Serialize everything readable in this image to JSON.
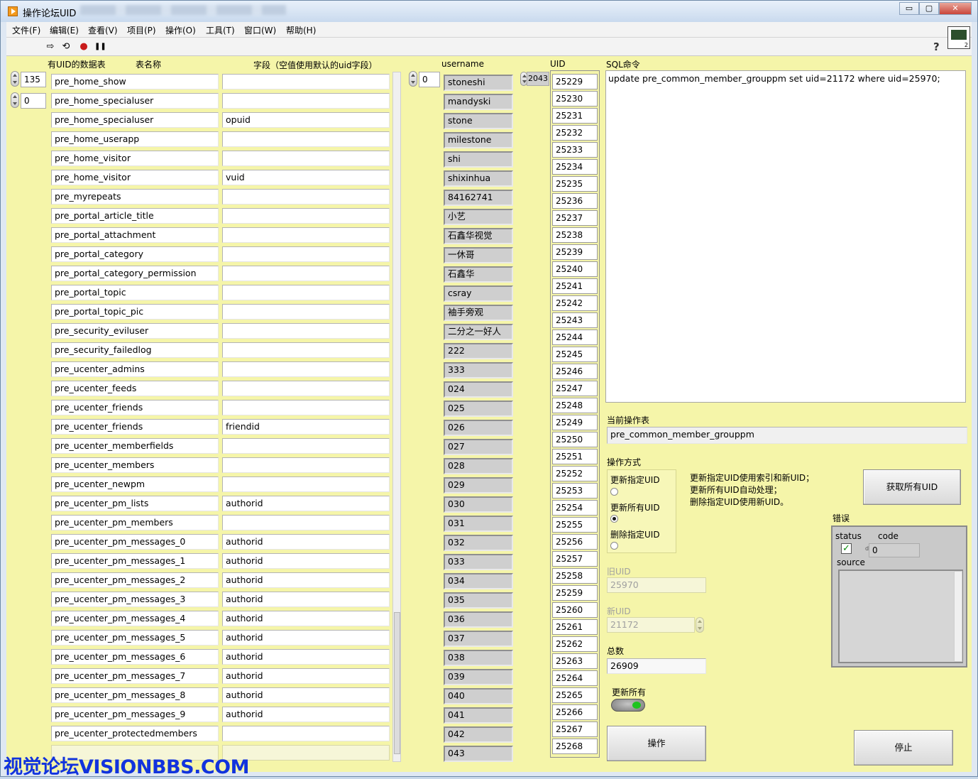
{
  "window": {
    "title": "操作论坛UID",
    "buttons": {
      "minimize": "▭",
      "maximize": "▢",
      "close": "✕"
    }
  },
  "menu": [
    {
      "label": "文件(F)"
    },
    {
      "label": "编辑(E)"
    },
    {
      "label": "查看(V)"
    },
    {
      "label": "项目(P)"
    },
    {
      "label": "操作(O)"
    },
    {
      "label": "工具(T)"
    },
    {
      "label": "窗口(W)"
    },
    {
      "label": "帮助(H)"
    }
  ],
  "toolbar": {
    "run_icon": "⇨",
    "run_cont_icon": "⟲",
    "abort_icon": "●",
    "pause_icon": "❚❚",
    "help": "?"
  },
  "tables": {
    "header_has_uid": "有UID的数据表",
    "header_name": "表名称",
    "header_field": "字段（空值使用默认的uid字段）",
    "index_row": "135",
    "index_col": "0",
    "rows": [
      {
        "name": "pre_home_show",
        "field": ""
      },
      {
        "name": "pre_home_specialuser",
        "field": ""
      },
      {
        "name": "pre_home_specialuser",
        "field": "opuid"
      },
      {
        "name": "pre_home_userapp",
        "field": ""
      },
      {
        "name": "pre_home_visitor",
        "field": ""
      },
      {
        "name": "pre_home_visitor",
        "field": "vuid"
      },
      {
        "name": "pre_myrepeats",
        "field": ""
      },
      {
        "name": "pre_portal_article_title",
        "field": ""
      },
      {
        "name": "pre_portal_attachment",
        "field": ""
      },
      {
        "name": "pre_portal_category",
        "field": ""
      },
      {
        "name": "pre_portal_category_permission",
        "field": ""
      },
      {
        "name": "pre_portal_topic",
        "field": ""
      },
      {
        "name": "pre_portal_topic_pic",
        "field": ""
      },
      {
        "name": "pre_security_eviluser",
        "field": ""
      },
      {
        "name": "pre_security_failedlog",
        "field": ""
      },
      {
        "name": "pre_ucenter_admins",
        "field": ""
      },
      {
        "name": "pre_ucenter_feeds",
        "field": ""
      },
      {
        "name": "pre_ucenter_friends",
        "field": ""
      },
      {
        "name": "pre_ucenter_friends",
        "field": "friendid"
      },
      {
        "name": "pre_ucenter_memberfields",
        "field": ""
      },
      {
        "name": "pre_ucenter_members",
        "field": ""
      },
      {
        "name": "pre_ucenter_newpm",
        "field": ""
      },
      {
        "name": "pre_ucenter_pm_lists",
        "field": "authorid"
      },
      {
        "name": "pre_ucenter_pm_members",
        "field": ""
      },
      {
        "name": "pre_ucenter_pm_messages_0",
        "field": "authorid"
      },
      {
        "name": "pre_ucenter_pm_messages_1",
        "field": "authorid"
      },
      {
        "name": "pre_ucenter_pm_messages_2",
        "field": "authorid"
      },
      {
        "name": "pre_ucenter_pm_messages_3",
        "field": "authorid"
      },
      {
        "name": "pre_ucenter_pm_messages_4",
        "field": "authorid"
      },
      {
        "name": "pre_ucenter_pm_messages_5",
        "field": "authorid"
      },
      {
        "name": "pre_ucenter_pm_messages_6",
        "field": "authorid"
      },
      {
        "name": "pre_ucenter_pm_messages_7",
        "field": "authorid"
      },
      {
        "name": "pre_ucenter_pm_messages_8",
        "field": "authorid"
      },
      {
        "name": "pre_ucenter_pm_messages_9",
        "field": "authorid"
      },
      {
        "name": "pre_ucenter_protectedmembers",
        "field": ""
      },
      {
        "name": "",
        "field": ""
      }
    ]
  },
  "users": {
    "header": "username",
    "index": "0",
    "names": [
      "stoneshi",
      "mandyski",
      "stone",
      "milestone",
      "shi",
      "shixinhua",
      "84162741",
      "小艺",
      "石鑫华视觉",
      "一休哥",
      "石鑫华",
      "csray",
      "袖手旁观",
      "二分之一好人",
      "222",
      "333",
      "024",
      "025",
      "026",
      "027",
      "028",
      "029",
      "030",
      "031",
      "032",
      "033",
      "034",
      "035",
      "036",
      "037",
      "038",
      "039",
      "040",
      "041",
      "042",
      "043"
    ]
  },
  "uids": {
    "header": "UID",
    "index": "2043",
    "values": [
      "25229",
      "25230",
      "25231",
      "25232",
      "25233",
      "25234",
      "25235",
      "25236",
      "25237",
      "25238",
      "25239",
      "25240",
      "25241",
      "25242",
      "25243",
      "25244",
      "25245",
      "25246",
      "25247",
      "25248",
      "25249",
      "25250",
      "25251",
      "25252",
      "25253",
      "25254",
      "25255",
      "25256",
      "25257",
      "25258",
      "25259",
      "25260",
      "25261",
      "25262",
      "25263",
      "25264",
      "25265",
      "25266",
      "25267",
      "25268"
    ]
  },
  "sql": {
    "label": "SQL命令",
    "text": "update pre_common_member_grouppm set uid=21172 where uid=25970;"
  },
  "current_table": {
    "label": "当前操作表",
    "value": "pre_common_member_grouppm"
  },
  "op_mode": {
    "label": "操作方式",
    "options": [
      {
        "label": "更新指定UID",
        "selected": false
      },
      {
        "label": "更新所有UID",
        "selected": true
      },
      {
        "label": "删除指定UID",
        "selected": false
      }
    ],
    "help_line1": "更新指定UID使用索引和新UID；",
    "help_line2": "更新所有UID自动处理；",
    "help_line3": "删除指定UID使用新UID。"
  },
  "old_uid": {
    "label": "旧UID",
    "value": "25970"
  },
  "new_uid": {
    "label": "新UID",
    "value": "21172"
  },
  "total": {
    "label": "总数",
    "value": "26909"
  },
  "update_all": {
    "label": "更新所有",
    "on": true
  },
  "buttons": {
    "get_all_uid": "获取所有UID",
    "operate": "操作",
    "stop": "停止"
  },
  "error": {
    "label": "错误",
    "status_label": "status",
    "code_label": "code",
    "code_value": "0",
    "code_prefix": "d",
    "source_label": "source",
    "status_ok": true
  },
  "watermark": "视觉论坛VISIONBBS.COM",
  "colors": {
    "panel": "#f5f5a9",
    "indicator": "#cfcfcf",
    "toggle_led": "#1fc41f",
    "watermark": "#1133dd"
  }
}
